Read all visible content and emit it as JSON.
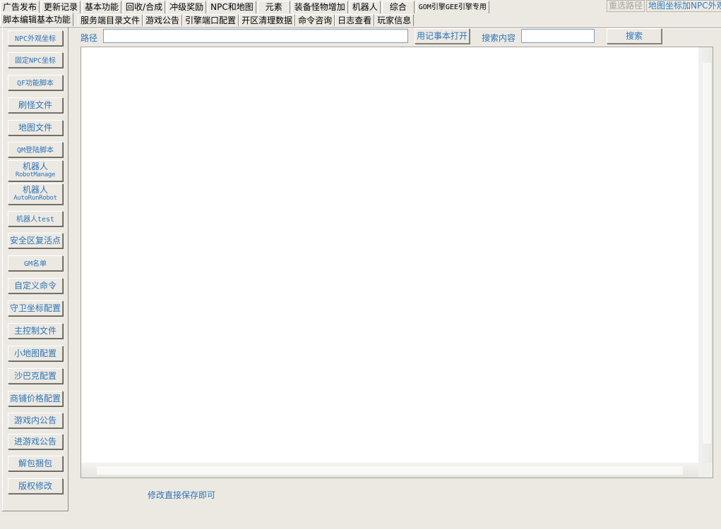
{
  "top_tabs": [
    "广告发布",
    "更新记录",
    "基本功能",
    "回收/合成",
    "冲级奖励",
    "NPC和地图",
    "元素",
    "装备怪物增加",
    "机器人",
    "综合",
    "GOM引擎GEE引擎专用"
  ],
  "top_right": {
    "reselect_path": "重选路径",
    "map_coord_btn": "地图坐标加NPC外观"
  },
  "sub_tabs": [
    "脚本编辑基本功能",
    "服务端目录文件",
    "游戏公告",
    "引擎端口配置",
    "开区清理数据",
    "命令咨询",
    "日志查看",
    "玩家信息"
  ],
  "sidebar": {
    "npc_look": "NPC外观坐标",
    "fixed_npc": "固定NPC坐标",
    "qf_script": "QF功能脚本",
    "monster_file": "刷怪文件",
    "map_file": "地图文件",
    "qm_login": "QM登陆脚本",
    "robot_manage_1": "机器人",
    "robot_manage_2": "RobotManage",
    "autorun_1": "机器人",
    "autorun_2": "AutoRunRobot",
    "robot_test": "机器人test",
    "safe_zone": "安全区复活点",
    "gm_list": "GM名单",
    "custom_cmd": "自定义命令",
    "guard_coord": "守卫坐标配置",
    "main_control": "主控制文件",
    "minimap": "小地图配置",
    "sabak": "沙巴克配置",
    "shop_price": "商铺价格配置",
    "ingame_notice": "游戏内公告",
    "enter_notice": "进游戏公告",
    "unpack": "解包捆包",
    "copyright": "版权修改"
  },
  "path_label": "路径",
  "path_value": "",
  "open_notepad": "用记事本打开",
  "search_label": "搜索内容",
  "search_value": "",
  "search_button": "搜索",
  "hint": "修改直接保存即可"
}
